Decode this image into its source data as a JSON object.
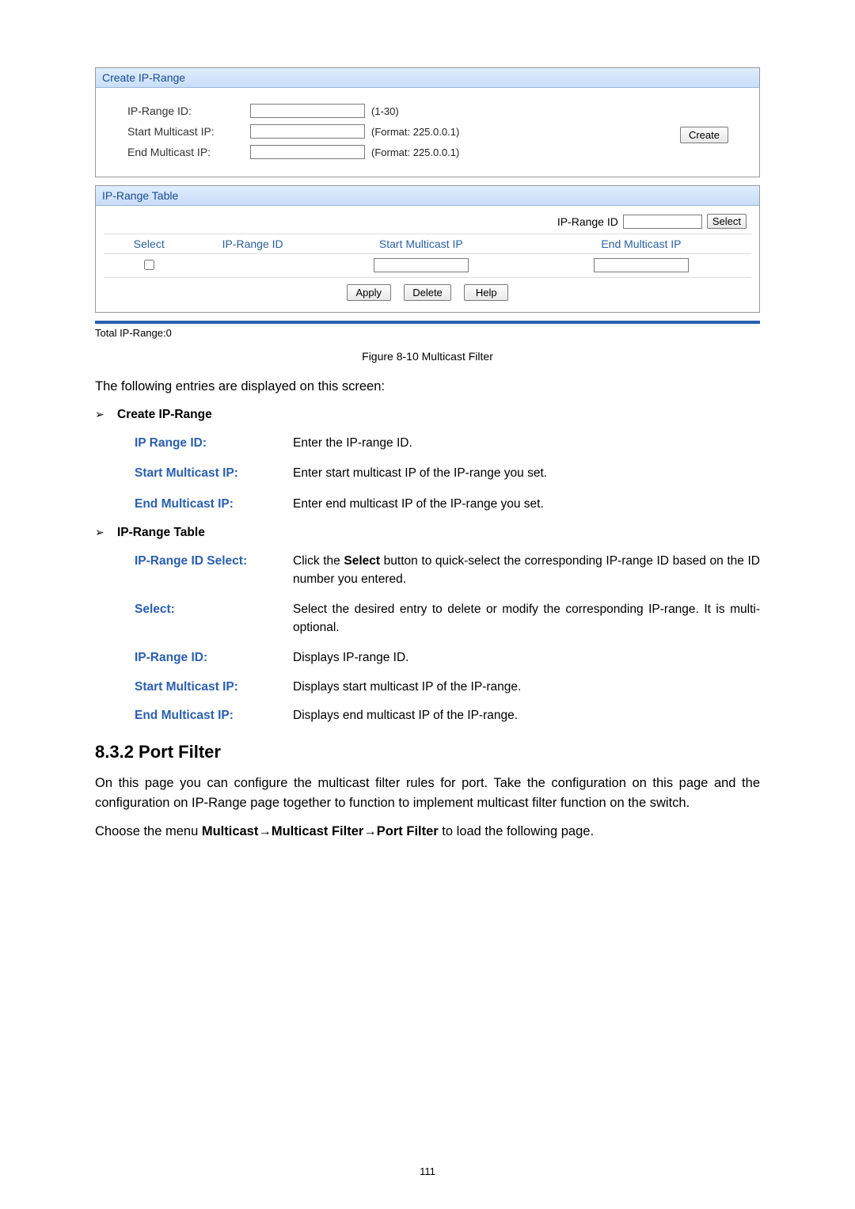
{
  "ui_create": {
    "header": "Create IP-Range",
    "rows": [
      {
        "label": "IP-Range ID:",
        "hint": "(1-30)"
      },
      {
        "label": "Start Multicast IP:",
        "hint": "(Format: 225.0.0.1)"
      },
      {
        "label": "End Multicast IP:",
        "hint": "(Format: 225.0.0.1)"
      }
    ],
    "create_btn": "Create"
  },
  "ui_table": {
    "header": "IP-Range Table",
    "filter_label": "IP-Range ID",
    "select_btn": "Select",
    "cols": {
      "select": "Select",
      "id": "IP-Range ID",
      "start": "Start Multicast IP",
      "end": "End Multicast IP"
    },
    "actions": {
      "apply": "Apply",
      "delete": "Delete",
      "help": "Help"
    },
    "total": "Total IP-Range:0"
  },
  "caption": "Figure 8-10 Multicast Filter",
  "intro": "The following entries are displayed on this screen:",
  "section_create": {
    "title": "Create IP-Range",
    "defs": [
      {
        "t": "IP Range ID:",
        "d": "Enter the IP-range ID."
      },
      {
        "t": "Start Multicast IP:",
        "d": "Enter start multicast IP of the IP-range you set."
      },
      {
        "t": "End Multicast IP:",
        "d": "Enter end multicast IP of the IP-range you set."
      }
    ]
  },
  "section_table": {
    "title": "IP-Range Table",
    "defs": [
      {
        "t": "IP-Range ID Select:",
        "d_before": "Click the ",
        "d_bold": "Select",
        "d_after": " button to quick-select the corresponding IP-range ID based on the ID number you entered."
      },
      {
        "t": "Select:",
        "d": "Select the desired entry to delete or modify the corresponding IP-range. It is multi-optional."
      },
      {
        "t": "IP-Range ID:",
        "d": "Displays IP-range ID."
      },
      {
        "t": "Start Multicast IP:",
        "d": "Displays start multicast IP of the IP-range."
      },
      {
        "t": "End Multicast IP:",
        "d": "Displays end multicast IP of the IP-range."
      }
    ]
  },
  "port_filter": {
    "heading": "8.3.2 Port Filter",
    "para": "On this page you can configure the multicast filter rules for port. Take the configuration on this page and the configuration on IP-Range page together to function to implement multicast filter function on the switch.",
    "menu_before": "Choose the menu ",
    "menu_bold": "Multicast→Multicast Filter→Port Filter",
    "menu_after": " to load the following page."
  },
  "page_number": "111"
}
